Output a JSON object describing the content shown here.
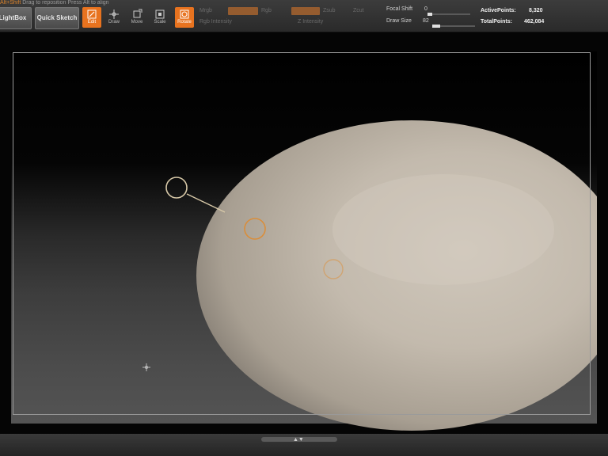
{
  "toolbar": {
    "hint_prefix": "Alt+Shift",
    "hint_mid": "Drag to reposition",
    "hint_suffix": "Press Alt to align",
    "lightbox_label": "LightBox",
    "quicksketch_label": "Quick Sketch",
    "tools": [
      {
        "name": "Edit",
        "icon": "edit-icon",
        "active": true
      },
      {
        "name": "Draw",
        "icon": "draw-icon",
        "active": false
      },
      {
        "name": "Move",
        "icon": "move-icon",
        "active": false
      },
      {
        "name": "Scale",
        "icon": "scale-icon",
        "active": false
      },
      {
        "name": "Rotate",
        "icon": "rotate-icon",
        "active": true
      }
    ],
    "mrgb_label": "Mrgb",
    "rgb_label": "Rgb",
    "rgb_intensity_label": "Rgb Intensity",
    "zadd_label": "Zadd",
    "zsub_label": "Zsub",
    "z_intensity_label": "Z Intensity",
    "focal_shift_label": "Focal Shift",
    "focal_shift_value": "0",
    "draw_size_label": "Draw Size",
    "draw_size_value": "82",
    "active_points_label": "ActivePoints:",
    "active_points_value": "8,320",
    "total_points_label": "TotalPoints:",
    "total_points_value": "462,084"
  },
  "colors": {
    "accent": "#e8731f",
    "object_base": "#c8bfb2",
    "ring": "#e08a2a"
  },
  "viewport": {
    "object": "sphere-mesh"
  }
}
